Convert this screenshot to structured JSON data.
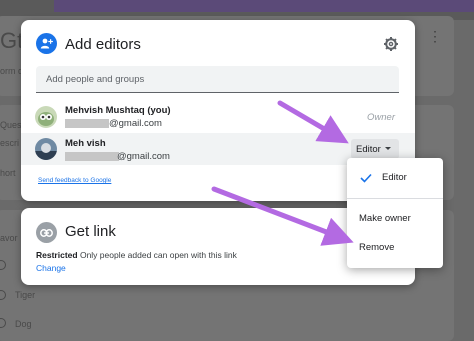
{
  "background": {
    "title_fragment": "Gt",
    "partial_texts": [
      "orm d",
      "Ques",
      "escri",
      "hort",
      "avor"
    ],
    "options": [
      "Tiger",
      "Dog"
    ]
  },
  "dialog": {
    "title": "Add editors",
    "header_icon": "add-person-icon",
    "settings_icon": "gear-icon",
    "add_people_placeholder": "Add people and groups",
    "people": [
      {
        "name": "Mehvish Mushtaq (you)",
        "email_visible": "@gmail.com",
        "role": "Owner"
      },
      {
        "name": "Meh vish",
        "email_visible": "@gmail.com",
        "role": "Editor"
      }
    ],
    "feedback_link": "Send feedback to Google"
  },
  "get_link": {
    "title": "Get link",
    "icon": "link-icon",
    "restricted_label": "Restricted",
    "restricted_desc": "Only people added can open with this link",
    "change_label": "Change"
  },
  "role_menu": {
    "items": [
      {
        "label": "Editor",
        "checked": true
      },
      {
        "label": "Make owner",
        "checked": false
      },
      {
        "label": "Remove",
        "checked": false
      }
    ]
  },
  "colors": {
    "accent": "#1a73e8",
    "annotation_arrow": "#b36ae2"
  }
}
